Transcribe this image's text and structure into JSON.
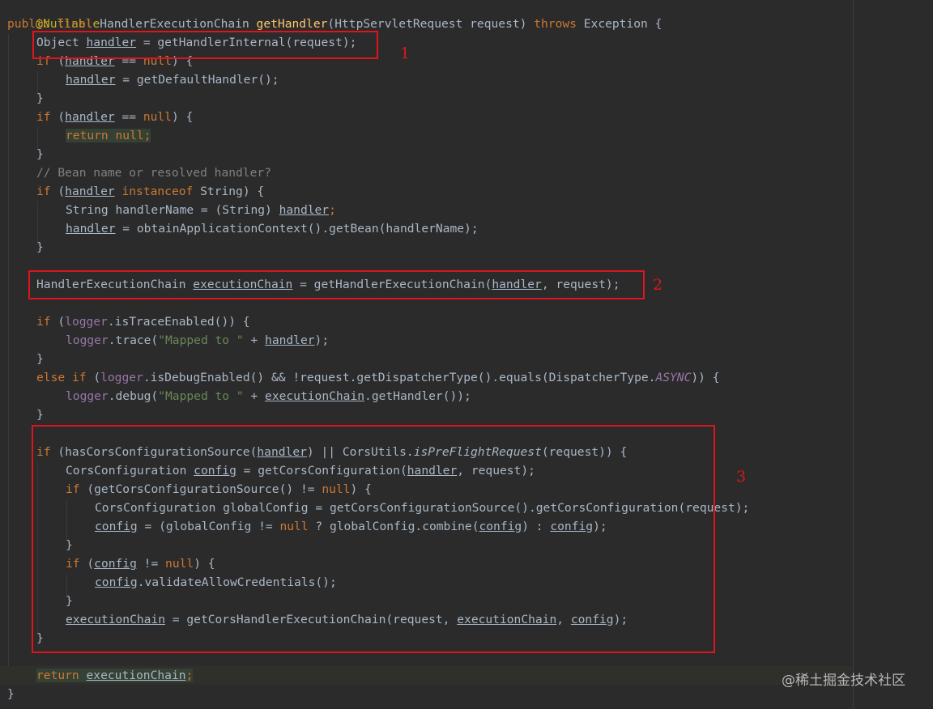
{
  "code": {
    "annotation": "@Nullable",
    "signature": {
      "modifiers": "public final",
      "return_type": "HandlerExecutionChain",
      "method": "getHandler",
      "params": "(HttpServletRequest request)",
      "throws_kw": "throws",
      "exception": "Exception {"
    },
    "lines": {
      "l3_type": "Object",
      "l3_var": "handler",
      "l3_rest": " = getHandlerInternal(request);",
      "if_kw": "if",
      "null_kw": "null",
      "return_kw": "return",
      "instanceof_kw": "instanceof",
      "else_kw": "else",
      "handler": "handler",
      "execution_chain": "executionChain",
      "config": "config",
      "close_brace": "}",
      "l5_rest": " = getDefaultHandler();",
      "l7_paren": " (",
      "l7_rest": " == ",
      "l7_end": ") {",
      "l8_semi": ";",
      "comment": "// Bean name or resolved handler?",
      "l11_end": " String) {",
      "l12_start": "String handlerName = (String) ",
      "l12_end": ";",
      "l13_rest": " = obtainApplicationContext().getBean(handlerName);",
      "l15_type": "HandlerExecutionChain ",
      "l15_mid": " = getHandlerExecutionChain(",
      "l15_end": ", request);",
      "logger": "logger",
      "l17_rest": ".isTraceEnabled()) {",
      "l18_mid": ".trace(",
      "l18_str": "\"Mapped to \"",
      "l18_plus": " + ",
      "l18_end": ");",
      "l20_mid": ".isDebugEnabled() && !request.getDispatcherType().equals(DispatcherType.",
      "async": "ASYNC",
      "l20_end": ")) {",
      "l21_mid": ".debug(",
      "l21_end": ".getHandler());",
      "l23_a": " (hasCorsConfigurationSource(",
      "l23_b": ") || CorsUtils.",
      "l23_m": "isPreFlightRequest",
      "l23_c": "(request)) {",
      "l24_type": "CorsConfiguration ",
      "l24_mid": " = getCorsConfiguration(",
      "l24_end": ", request);",
      "l25_mid": " (getCorsConfigurationSource() != ",
      "l25_end": ") {",
      "l26": "CorsConfiguration globalConfig = getCorsConfigurationSource().getCorsConfiguration(request);",
      "l27_a": " = (globalConfig != ",
      "l27_b": " ? globalConfig.combine(",
      "l27_c": ") : ",
      "l27_d": ");",
      "l29_mid": " != ",
      "l29_end": ") {",
      "l30_end": ".validateAllowCredentials();",
      "l32_mid": " = getCorsHandlerExecutionChain(request, ",
      "comma": ", ",
      "l32_end": ");",
      "l34_semi": ";"
    }
  },
  "callouts": {
    "one": "1",
    "two": "2",
    "three": "3"
  },
  "watermark": "@稀土掘金技术社区",
  "colors": {
    "background": "#2b2b2b",
    "keyword": "#cc7832",
    "method": "#ffc66d",
    "string": "#6a8759",
    "field": "#9876aa",
    "comment": "#808080",
    "annotation": "#bbb529",
    "callout": "#e0141c"
  }
}
